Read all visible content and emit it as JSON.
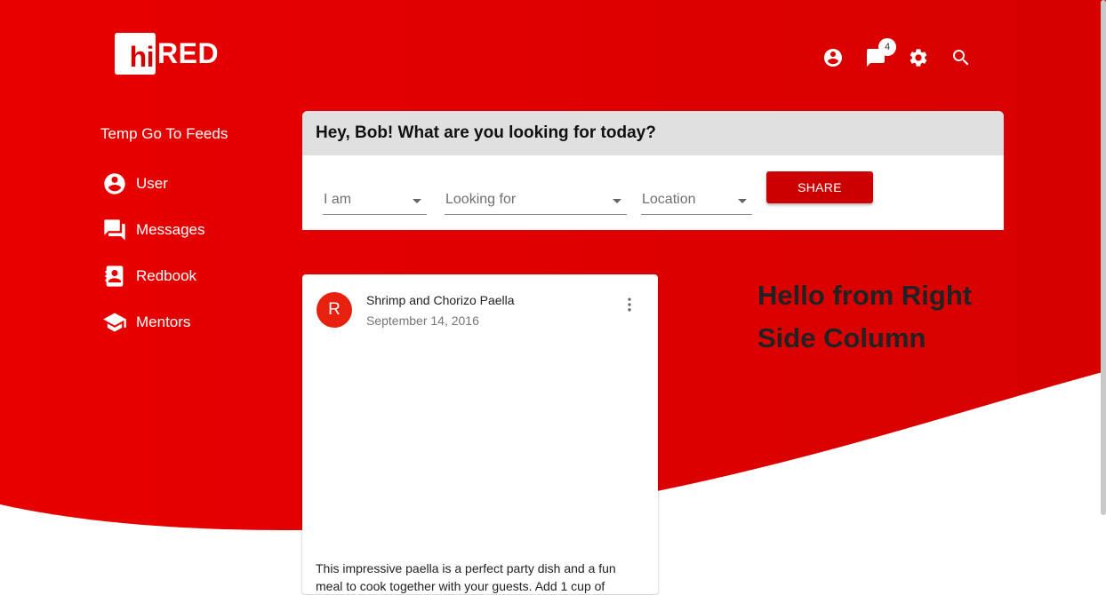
{
  "brand": {
    "logo_box": "hi",
    "logo_rest": "RED",
    "color": "#d40000"
  },
  "header": {
    "icons": [
      "account-circle-icon",
      "chat-icon",
      "settings-icon",
      "search-icon"
    ],
    "notification_count": "4"
  },
  "sidebar": {
    "title": "Temp Go To Feeds",
    "items": [
      {
        "label": "User",
        "icon": "account-circle-icon"
      },
      {
        "label": "Messages",
        "icon": "forum-icon"
      },
      {
        "label": "Redbook",
        "icon": "contact-book-icon"
      },
      {
        "label": "Mentors",
        "icon": "graduation-cap-icon"
      }
    ]
  },
  "search": {
    "greeting": "Hey, Bob! What are you looking for today?",
    "fields": [
      {
        "placeholder": "I am"
      },
      {
        "placeholder": "Looking for"
      },
      {
        "placeholder": "Location"
      }
    ],
    "share_label": "SHARE"
  },
  "post": {
    "avatar_letter": "R",
    "title": "Shrimp and Chorizo Paella",
    "date": "September 14, 2016",
    "body": "This impressive paella is a perfect party dish and a fun meal to cook together with your guests. Add 1 cup of"
  },
  "right_column": {
    "heading": "Hello from Right Side Column"
  }
}
